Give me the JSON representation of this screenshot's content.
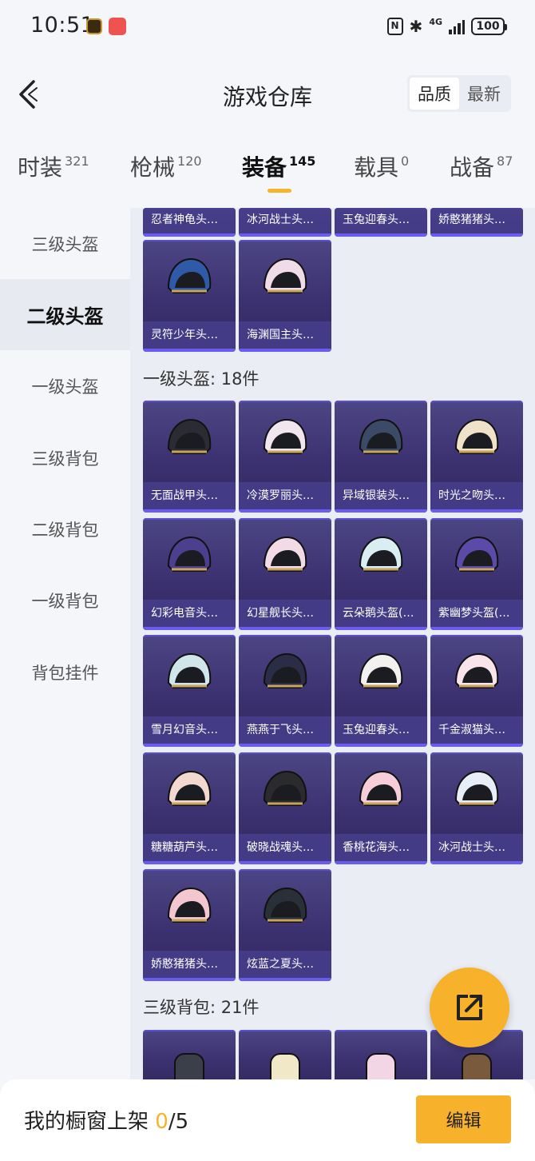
{
  "status_bar": {
    "time": "10:51",
    "app_badge_text": "bubble",
    "network": "4G",
    "battery": "100",
    "nfc": "N"
  },
  "header": {
    "title": "游戏仓库",
    "back_icon": "back-arrow-icon",
    "sort_options": [
      "品质",
      "最新"
    ],
    "active_sort": "品质"
  },
  "category_tabs": [
    {
      "label": "时装",
      "count": "321"
    },
    {
      "label": "枪械",
      "count": "120"
    },
    {
      "label": "装备",
      "count": "145",
      "active": true
    },
    {
      "label": "载具",
      "count": "0"
    },
    {
      "label": "战备",
      "count": "87"
    }
  ],
  "sidebar": {
    "items": [
      "三级头盔",
      "二级头盔",
      "一级头盔",
      "三级背包",
      "二级背包",
      "一级背包",
      "背包挂件"
    ],
    "active": "二级头盔"
  },
  "content": {
    "partial_top_row": [
      "忍者神龟头…",
      "冰河战士头…",
      "玉兔迎春头…",
      "娇憨猪猪头…"
    ],
    "level2_tail": [
      "灵符少年头…",
      "海渊国主头…"
    ],
    "level1_title": "一级头盔: 18件",
    "level1_items": [
      "无面战甲头…",
      "冷漠罗丽头…",
      "异域银装头…",
      "时光之吻头…",
      "幻彩电音头…",
      "幻星舰长头…",
      "云朵鹅头盔(…",
      "紫幽梦头盔(…",
      "雪月幻音头…",
      "燕燕于飞头…",
      "玉兔迎春头…",
      "千金淑猫头…",
      "糖糖葫芦头…",
      "破晓战魂头…",
      "香桃花海头…",
      "冰河战士头…",
      "娇憨猪猪头…",
      "炫蓝之夏头…"
    ],
    "level3_bag_title": "三级背包: 21件"
  },
  "colors": {
    "accent": "#f7b12a",
    "card_bg": "#3c3170",
    "card_border": "#6a5cf0"
  },
  "fab": {
    "icon": "share-icon"
  },
  "bottom_bar": {
    "label": "我的橱窗上架",
    "current": "0",
    "total": "/5",
    "edit_label": "编辑"
  }
}
